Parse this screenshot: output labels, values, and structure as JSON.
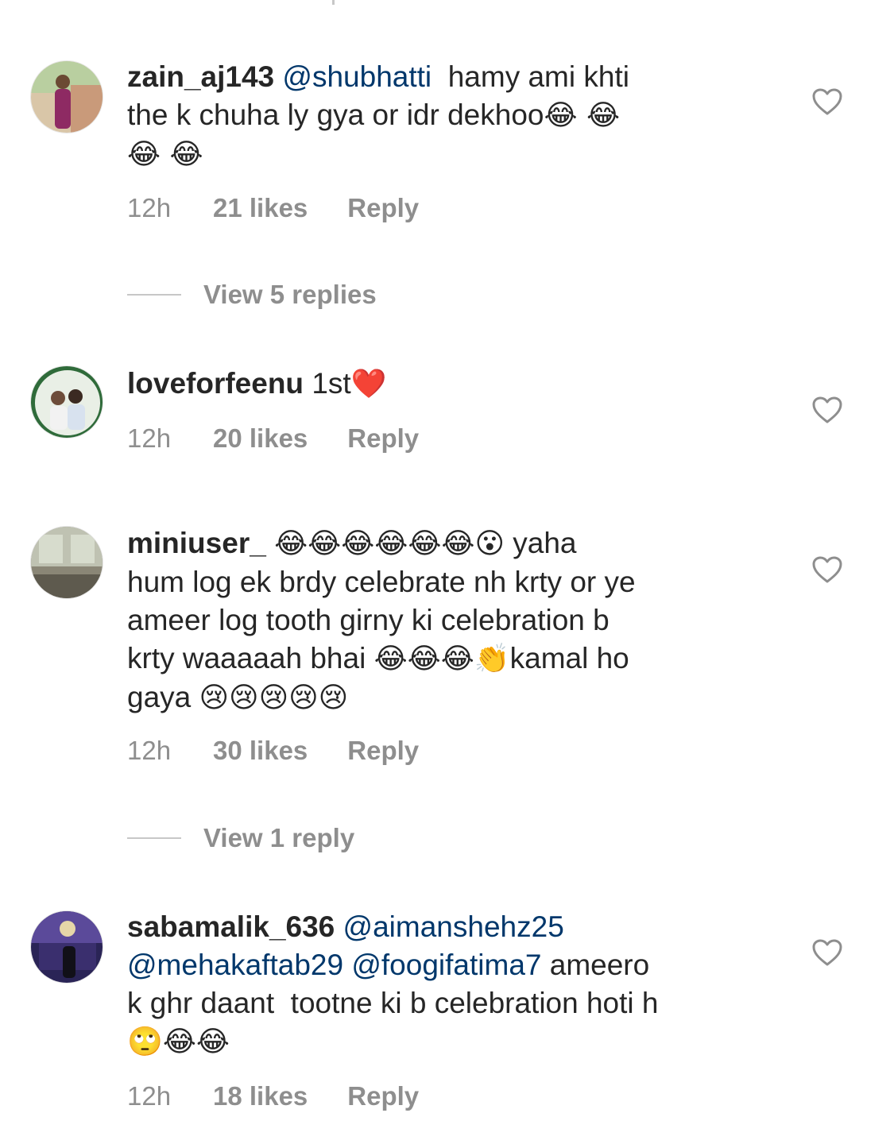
{
  "comments": [
    {
      "username": "zain_aj143",
      "lines": [
        {
          "mention": "@shubhatti",
          "text": "  hamy ami khti"
        },
        {
          "text": "the k chuha ly gya or idr dekhoo",
          "emoji": "😂 😂"
        },
        {
          "emoji": "😂 😂"
        }
      ],
      "time": "12h",
      "likes": "21 likes",
      "reply": "Reply",
      "view_replies": "View 5 replies"
    },
    {
      "username": "loveforfeenu",
      "lines": [
        {
          "text": "1st",
          "emoji": "❤️"
        }
      ],
      "time": "12h",
      "likes": "20 likes",
      "reply": "Reply"
    },
    {
      "username": "miniuser_",
      "lines": [
        {
          "emoji": "😂😂😂😂😂😂😮",
          "text": " yaha"
        },
        {
          "text": "hum log ek brdy celebrate nh krty or ye"
        },
        {
          "text": "ameer log tooth girny ki celebration b"
        },
        {
          "text": "krty waaaaah bhai ",
          "emoji": "😂😂😂👏",
          "text2": "kamal ho"
        },
        {
          "text": "gaya ",
          "emoji": "😢😢😢😢😢"
        }
      ],
      "time": "12h",
      "likes": "30 likes",
      "reply": "Reply",
      "view_replies": "View 1 reply"
    },
    {
      "username": "sabamalik_636",
      "lines": [
        {
          "mention": "@aimanshehz25"
        },
        {
          "mention": "@mehakaftab29 @foogifatima7",
          "text": " ameero"
        },
        {
          "text": "k ghr daant  tootne ki b celebration hoti h"
        },
        {
          "emoji": "🙄😂😂"
        }
      ],
      "time": "12h",
      "likes": "18 likes",
      "reply": "Reply"
    }
  ],
  "icons": {
    "like": "heart-outline-icon"
  },
  "colors": {
    "text": "#262626",
    "meta": "#8e8e8e",
    "mention": "#00376b",
    "divider": "#c7c7c7"
  }
}
